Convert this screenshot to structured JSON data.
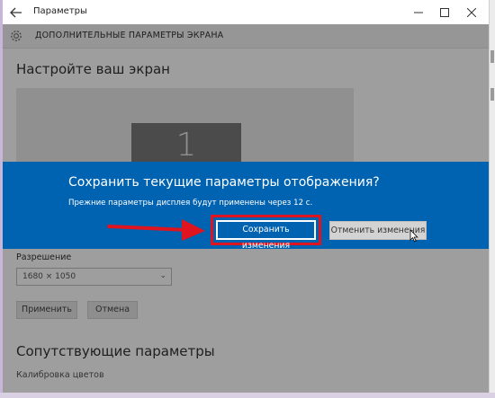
{
  "window": {
    "title": "Параметры"
  },
  "header": {
    "title": "ДОПОЛНИТЕЛЬНЫЕ ПАРАМЕТРЫ ЭКРАНА"
  },
  "content": {
    "heading": "Настройте ваш экран",
    "monitor_number": "1",
    "resolution_label": "Разрешение",
    "resolution_value": "1680 × 1050",
    "apply_label": "Применить",
    "cancel_label": "Отмена",
    "related_heading": "Сопутствующие параметры",
    "calibration_link": "Калибровка цветов"
  },
  "dialog": {
    "title": "Сохранить текущие параметры отображения?",
    "message": "Прежние параметры дисплея будут применены через 12 с.",
    "save_label": "Сохранить изменения",
    "revert_label": "Отменить изменения"
  },
  "colors": {
    "accent": "#0063b1",
    "highlight": "#e0141e"
  }
}
